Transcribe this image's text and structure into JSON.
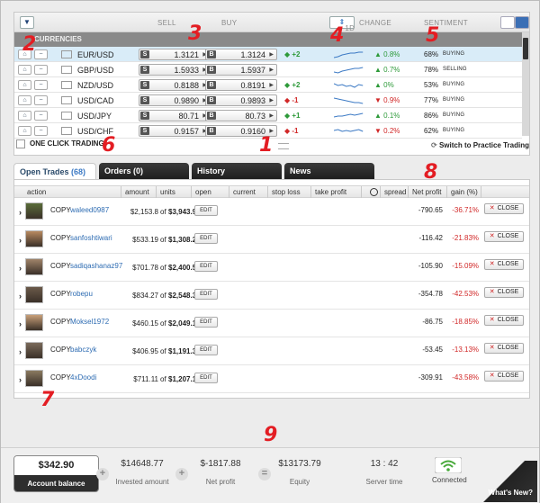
{
  "header": {
    "filter_icon": "filter-icon",
    "sell": "SELL",
    "buy": "BUY",
    "period": "1D",
    "change": "CHANGE",
    "sentiment": "SENTIMENT",
    "section": "CURRENCIES"
  },
  "pairs": [
    {
      "name": "EUR/USD",
      "flag": "eu-us",
      "sell": "1.3121",
      "buy": "1.3124",
      "diff": "+2",
      "diff_dir": "up",
      "change": "0.8%",
      "change_dir": "up",
      "pct": "68%",
      "label": "BUYING",
      "selected": true
    },
    {
      "name": "GBP/USD",
      "flag": "gb-us",
      "sell": "1.5933",
      "buy": "1.5937",
      "diff": "",
      "diff_dir": "",
      "change": "0.7%",
      "change_dir": "up",
      "pct": "78%",
      "label": "SELLING",
      "selected": false
    },
    {
      "name": "NZD/USD",
      "flag": "nz-us",
      "sell": "0.8188",
      "buy": "0.8191",
      "diff": "+2",
      "diff_dir": "up",
      "change": "0%",
      "change_dir": "up",
      "pct": "53%",
      "label": "BUYING",
      "selected": false
    },
    {
      "name": "USD/CAD",
      "flag": "us-ca",
      "sell": "0.9890",
      "buy": "0.9893",
      "diff": "-1",
      "diff_dir": "down",
      "change": "0.9%",
      "change_dir": "down",
      "pct": "77%",
      "label": "BUYING",
      "selected": false
    },
    {
      "name": "USD/JPY",
      "flag": "us-jp",
      "sell": "80.71",
      "buy": "80.73",
      "diff": "+1",
      "diff_dir": "up",
      "change": "0.1%",
      "change_dir": "up",
      "pct": "86%",
      "label": "BUYING",
      "selected": false
    },
    {
      "name": "USD/CHF",
      "flag": "us-ch",
      "sell": "0.9157",
      "buy": "0.9160",
      "diff": "-1",
      "diff_dir": "down",
      "change": "0.2%",
      "change_dir": "down",
      "pct": "62%",
      "label": "BUYING",
      "selected": false
    }
  ],
  "footer_panel": {
    "one_click": "ONE CLICK TRADING",
    "practice": "Switch to Practice Trading"
  },
  "tabs": [
    {
      "label": "Open Trades",
      "count": "(68)"
    },
    {
      "label": "Orders (0)",
      "count": ""
    },
    {
      "label": "History",
      "count": ""
    },
    {
      "label": "News",
      "count": ""
    }
  ],
  "columns": [
    "action",
    "amount",
    "units",
    "open",
    "current",
    "stop loss",
    "take profit",
    "spread",
    "Net profit",
    "gain (%)"
  ],
  "trades": [
    {
      "copy": "COPY",
      "user": "waleed0987",
      "amount": "$2,153.8",
      "of": "of",
      "units": "$3,943.9",
      "edit": "EDIT",
      "net": "-790.65",
      "gain": "-36.71%",
      "close": "CLOSE"
    },
    {
      "copy": "COPY",
      "user": "sanfoshtiwari",
      "amount": "$533.19",
      "of": "of",
      "units": "$1,308.2",
      "edit": "EDIT",
      "net": "-116.42",
      "gain": "-21.83%",
      "close": "CLOSE"
    },
    {
      "copy": "COPY",
      "user": "sadiqashanaz97",
      "amount": "$701.78",
      "of": "of",
      "units": "$2,400.5",
      "edit": "EDIT",
      "net": "-105.90",
      "gain": "-15.09%",
      "close": "CLOSE"
    },
    {
      "copy": "COPY",
      "user": "robepu",
      "amount": "$834.27",
      "of": "of",
      "units": "$2,548.3",
      "edit": "EDIT",
      "net": "-354.78",
      "gain": "-42.53%",
      "close": "CLOSE"
    },
    {
      "copy": "COPY",
      "user": "Moksel1972",
      "amount": "$460.15",
      "of": "of",
      "units": "$2,049.1",
      "edit": "EDIT",
      "net": "-86.75",
      "gain": "-18.85%",
      "close": "CLOSE"
    },
    {
      "copy": "COPY",
      "user": "babczyk",
      "amount": "$406.95",
      "of": "of",
      "units": "$1,191.3",
      "edit": "EDIT",
      "net": "-53.45",
      "gain": "-13.13%",
      "close": "CLOSE"
    },
    {
      "copy": "COPY",
      "user": "4xDoodi",
      "amount": "$711.11",
      "of": "of",
      "units": "$1,207.1",
      "edit": "EDIT",
      "net": "-309.91",
      "gain": "-43.58%",
      "close": "CLOSE"
    }
  ],
  "summary": {
    "balance": "$342.90",
    "balance_label": "Account balance",
    "invested": "$14648.77",
    "invested_label": "Invested amount",
    "net": "$-1817.88",
    "net_label": "Net profit",
    "equity": "$13173.79",
    "equity_label": "Equity",
    "time": "13 : 42",
    "time_label": "Server time",
    "status": "Connected",
    "whats_new": "What's New?"
  },
  "annotations": [
    "1",
    "2",
    "3",
    "4",
    "5",
    "6",
    "7",
    "8",
    "9"
  ],
  "colors": {
    "up": "#2e9a3a",
    "down": "#d12828",
    "annotation": "#e31d23",
    "accent": "#3b79c4"
  }
}
